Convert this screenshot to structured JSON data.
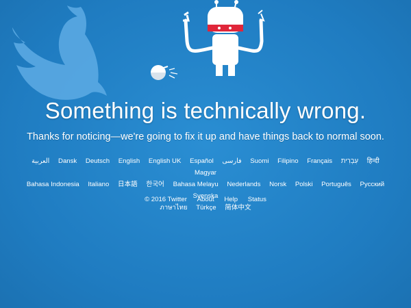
{
  "headline": "Something is technically wrong.",
  "subheadline": "Thanks for noticing—we're going to fix it up and have things back to normal soon.",
  "languages": [
    "العربية",
    "Dansk",
    "Deutsch",
    "English",
    "English UK",
    "Español",
    "فارسی",
    "Suomi",
    "Filipino",
    "Français",
    "עִבְרִית",
    "हिन्दी",
    "Magyar",
    "Bahasa Indonesia",
    "Italiano",
    "日本語",
    "한국어",
    "Bahasa Melayu",
    "Nederlands",
    "Norsk",
    "Polski",
    "Português",
    "Русский",
    "Svenska",
    "ภาษาไทย",
    "Türkçe",
    "简体中文"
  ],
  "footer": {
    "copyright": "© 2016 Twitter",
    "about": "About",
    "help": "Help",
    "status": "Status"
  },
  "colors": {
    "background": "#1f7cc1",
    "bird": "#5aa8e2",
    "robot_band": "#e0263a"
  },
  "illustration": {
    "bird": "twitter-bird-icon",
    "robot": "robot-icon",
    "broken_part": "broken-robot-head-icon"
  }
}
